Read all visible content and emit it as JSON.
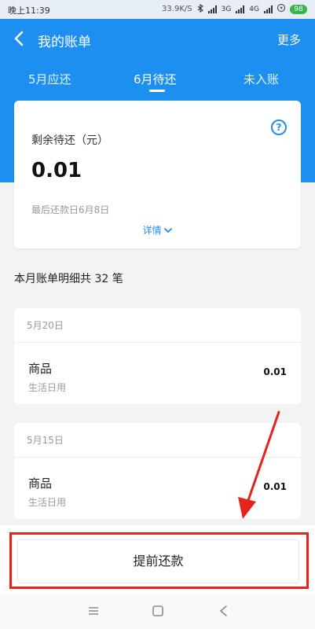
{
  "status_bar": {
    "time": "晚上11:39",
    "speed": "33.9K/S",
    "net1": "3G",
    "net2": "4G",
    "battery": "98"
  },
  "header": {
    "title": "我的账单",
    "more_label": "更多"
  },
  "tabs": [
    {
      "label": "5月应还"
    },
    {
      "label": "6月待还"
    },
    {
      "label": "未入账"
    }
  ],
  "summary": {
    "remaining_label": "剩余待还（元）",
    "amount": "0.01",
    "due_text": "最后还款日6月8日",
    "details_label": "详情"
  },
  "section": {
    "title": "本月账单明细共 32 笔"
  },
  "groups": [
    {
      "date": "5月20日",
      "item": {
        "name": "商品",
        "category": "生活日用",
        "amount": "0.01"
      }
    },
    {
      "date": "5月15日",
      "item": {
        "name": "商品",
        "category": "生活日用",
        "amount": "0.01"
      }
    }
  ],
  "bottom": {
    "prepay_label": "提前还款"
  },
  "colors": {
    "primary": "#1d8ff0",
    "highlight": "#e5231d",
    "battery": "#39b54a"
  },
  "icons": {
    "back": "chevron-left-icon",
    "help": "question-circle-icon",
    "details": "chevron-down-icon",
    "menu": "menu-icon",
    "home": "square-home-icon",
    "back_nav": "triangle-back-icon"
  }
}
